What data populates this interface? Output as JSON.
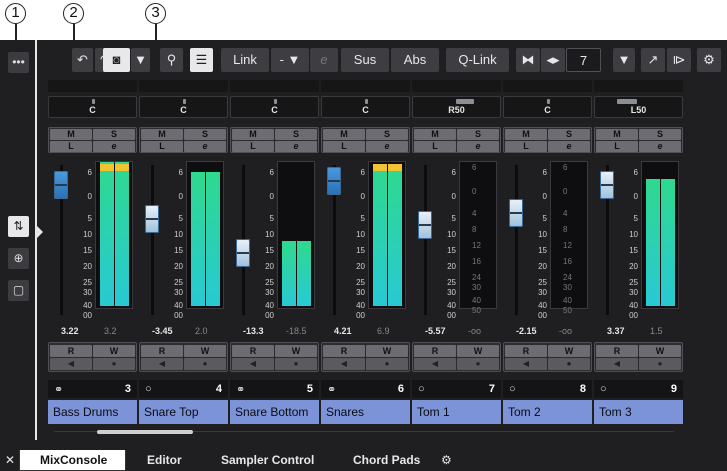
{
  "callouts": [
    "1",
    "2",
    "3"
  ],
  "toolbar": {
    "more_icon": "ellipsis-icon",
    "undo_icon": "undo-icon",
    "redo_icon": "redo-icon",
    "snapshot_icon": "camera-icon",
    "dropdown_glyph": "▼",
    "zoom_icon": "magnifier-icon",
    "channel_list_icon": "list-icon",
    "link_label": "Link",
    "link_mode_label": "-",
    "link_e_label": "e",
    "sus_label": "Sus",
    "abs_label": "Abs",
    "qlink_label": "Q-Link",
    "zoom_value": "7",
    "window_zoom_glyph": "⧐",
    "arrows_glyph": "◂▸"
  },
  "left_panel": {
    "faders_icon": "faders-icon",
    "routing_icon": "routing-icon",
    "rack_icon": "rack-icon"
  },
  "strip_labels": {
    "mute": "M",
    "solo": "S",
    "listen": "L",
    "edit": "e",
    "read": "R",
    "write": "W"
  },
  "scale_marks": [
    "6",
    "0",
    "5",
    "10",
    "15",
    "20",
    "25",
    "30",
    "40",
    "00"
  ],
  "meter_marks": [
    "6",
    "0",
    "4",
    "8",
    "12",
    "16",
    "24",
    "30",
    "40",
    "50"
  ],
  "channels": [
    {
      "pan": "C",
      "vol": "3.22",
      "peak": "3.2",
      "num": "3",
      "name": "Bass Drums",
      "linked": true
    },
    {
      "pan": "C",
      "vol": "-3.45",
      "peak": "2.0",
      "num": "4",
      "name": "Snare Top",
      "linked": false
    },
    {
      "pan": "C",
      "vol": "-13.3",
      "peak": "-18.5",
      "num": "5",
      "name": "Snare Bottom",
      "linked": true
    },
    {
      "pan": "C",
      "vol": "4.21",
      "peak": "6.9",
      "num": "6",
      "name": "Snares",
      "linked": true
    },
    {
      "pan": "R50",
      "vol": "-5.57",
      "peak": "-oo",
      "num": "7",
      "name": "Tom 1",
      "linked": false
    },
    {
      "pan": "C",
      "vol": "-2.15",
      "peak": "-oo",
      "num": "8",
      "name": "Tom 2",
      "linked": false
    },
    {
      "pan": "L50",
      "vol": "3.37",
      "peak": "1.5",
      "num": "9",
      "name": "Tom 3",
      "linked": false
    }
  ],
  "tabs": {
    "close_glyph": "✕",
    "mixconsole": "MixConsole",
    "editor": "Editor",
    "sampler_control": "Sampler Control",
    "chord_pads": "Chord Pads",
    "settings_icon": "gear-icon"
  }
}
